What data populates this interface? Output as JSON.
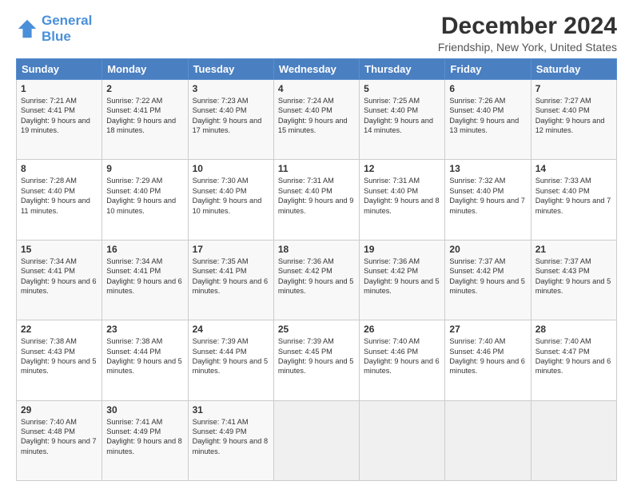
{
  "logo": {
    "line1": "General",
    "line2": "Blue"
  },
  "title": "December 2024",
  "subtitle": "Friendship, New York, United States",
  "weekdays": [
    "Sunday",
    "Monday",
    "Tuesday",
    "Wednesday",
    "Thursday",
    "Friday",
    "Saturday"
  ],
  "weeks": [
    [
      {
        "day": "1",
        "sunrise": "7:21 AM",
        "sunset": "4:41 PM",
        "daylight": "9 hours and 19 minutes."
      },
      {
        "day": "2",
        "sunrise": "7:22 AM",
        "sunset": "4:41 PM",
        "daylight": "9 hours and 18 minutes."
      },
      {
        "day": "3",
        "sunrise": "7:23 AM",
        "sunset": "4:40 PM",
        "daylight": "9 hours and 17 minutes."
      },
      {
        "day": "4",
        "sunrise": "7:24 AM",
        "sunset": "4:40 PM",
        "daylight": "9 hours and 15 minutes."
      },
      {
        "day": "5",
        "sunrise": "7:25 AM",
        "sunset": "4:40 PM",
        "daylight": "9 hours and 14 minutes."
      },
      {
        "day": "6",
        "sunrise": "7:26 AM",
        "sunset": "4:40 PM",
        "daylight": "9 hours and 13 minutes."
      },
      {
        "day": "7",
        "sunrise": "7:27 AM",
        "sunset": "4:40 PM",
        "daylight": "9 hours and 12 minutes."
      }
    ],
    [
      {
        "day": "8",
        "sunrise": "7:28 AM",
        "sunset": "4:40 PM",
        "daylight": "9 hours and 11 minutes."
      },
      {
        "day": "9",
        "sunrise": "7:29 AM",
        "sunset": "4:40 PM",
        "daylight": "9 hours and 10 minutes."
      },
      {
        "day": "10",
        "sunrise": "7:30 AM",
        "sunset": "4:40 PM",
        "daylight": "9 hours and 10 minutes."
      },
      {
        "day": "11",
        "sunrise": "7:31 AM",
        "sunset": "4:40 PM",
        "daylight": "9 hours and 9 minutes."
      },
      {
        "day": "12",
        "sunrise": "7:31 AM",
        "sunset": "4:40 PM",
        "daylight": "9 hours and 8 minutes."
      },
      {
        "day": "13",
        "sunrise": "7:32 AM",
        "sunset": "4:40 PM",
        "daylight": "9 hours and 7 minutes."
      },
      {
        "day": "14",
        "sunrise": "7:33 AM",
        "sunset": "4:40 PM",
        "daylight": "9 hours and 7 minutes."
      }
    ],
    [
      {
        "day": "15",
        "sunrise": "7:34 AM",
        "sunset": "4:41 PM",
        "daylight": "9 hours and 6 minutes."
      },
      {
        "day": "16",
        "sunrise": "7:34 AM",
        "sunset": "4:41 PM",
        "daylight": "9 hours and 6 minutes."
      },
      {
        "day": "17",
        "sunrise": "7:35 AM",
        "sunset": "4:41 PM",
        "daylight": "9 hours and 6 minutes."
      },
      {
        "day": "18",
        "sunrise": "7:36 AM",
        "sunset": "4:42 PM",
        "daylight": "9 hours and 5 minutes."
      },
      {
        "day": "19",
        "sunrise": "7:36 AM",
        "sunset": "4:42 PM",
        "daylight": "9 hours and 5 minutes."
      },
      {
        "day": "20",
        "sunrise": "7:37 AM",
        "sunset": "4:42 PM",
        "daylight": "9 hours and 5 minutes."
      },
      {
        "day": "21",
        "sunrise": "7:37 AM",
        "sunset": "4:43 PM",
        "daylight": "9 hours and 5 minutes."
      }
    ],
    [
      {
        "day": "22",
        "sunrise": "7:38 AM",
        "sunset": "4:43 PM",
        "daylight": "9 hours and 5 minutes."
      },
      {
        "day": "23",
        "sunrise": "7:38 AM",
        "sunset": "4:44 PM",
        "daylight": "9 hours and 5 minutes."
      },
      {
        "day": "24",
        "sunrise": "7:39 AM",
        "sunset": "4:44 PM",
        "daylight": "9 hours and 5 minutes."
      },
      {
        "day": "25",
        "sunrise": "7:39 AM",
        "sunset": "4:45 PM",
        "daylight": "9 hours and 5 minutes."
      },
      {
        "day": "26",
        "sunrise": "7:40 AM",
        "sunset": "4:46 PM",
        "daylight": "9 hours and 6 minutes."
      },
      {
        "day": "27",
        "sunrise": "7:40 AM",
        "sunset": "4:46 PM",
        "daylight": "9 hours and 6 minutes."
      },
      {
        "day": "28",
        "sunrise": "7:40 AM",
        "sunset": "4:47 PM",
        "daylight": "9 hours and 6 minutes."
      }
    ],
    [
      {
        "day": "29",
        "sunrise": "7:40 AM",
        "sunset": "4:48 PM",
        "daylight": "9 hours and 7 minutes."
      },
      {
        "day": "30",
        "sunrise": "7:41 AM",
        "sunset": "4:49 PM",
        "daylight": "9 hours and 8 minutes."
      },
      {
        "day": "31",
        "sunrise": "7:41 AM",
        "sunset": "4:49 PM",
        "daylight": "9 hours and 8 minutes."
      },
      null,
      null,
      null,
      null
    ]
  ]
}
